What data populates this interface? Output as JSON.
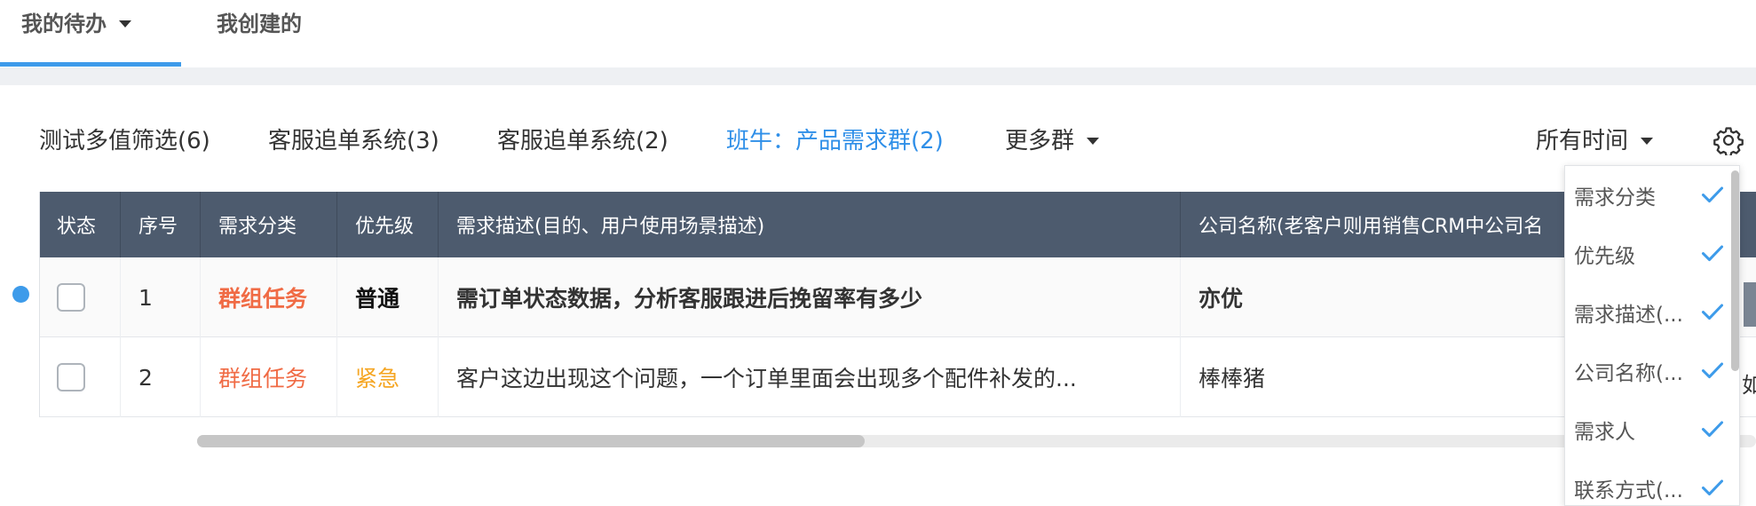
{
  "tabs": [
    {
      "label": "我的待办",
      "active": true
    },
    {
      "label": "我创建的",
      "active": false
    }
  ],
  "filters": [
    {
      "label": "测试多值筛选(6)",
      "active": false
    },
    {
      "label": "客服追单系统(3)",
      "active": false
    },
    {
      "label": "客服追单系统(2)",
      "active": false
    },
    {
      "label": "班牛：产品需求群(2)",
      "active": true
    },
    {
      "label": "更多群",
      "active": false
    }
  ],
  "time_filter": {
    "label": "所有时间"
  },
  "table": {
    "columns": [
      "状态",
      "序号",
      "需求分类",
      "优先级",
      "需求描述(目的、用户使用场景描述)",
      "公司名称(老客户则用销售CRM中公司名"
    ],
    "rows": [
      {
        "index": "1",
        "category": "群组任务",
        "priority": "普通",
        "description": "需订单状态数据，分析客服跟进后挽留率有多少",
        "company": "亦优",
        "unread": true
      },
      {
        "index": "2",
        "category": "群组任务",
        "priority": "紧急",
        "description": "客户这边出现这个问题，一个订单里面会出现多个配件补发的...",
        "company": "棒棒猪",
        "unread": false
      }
    ]
  },
  "column_menu": [
    {
      "label": "需求分类",
      "checked": true
    },
    {
      "label": "优先级",
      "checked": true
    },
    {
      "label": "需求描述(...",
      "checked": true
    },
    {
      "label": "公司名称(...",
      "checked": true
    },
    {
      "label": "需求人",
      "checked": true
    },
    {
      "label": "联系方式(...",
      "checked": true
    }
  ],
  "right_edge_text": "如",
  "colors": {
    "accent": "#3d9bea",
    "header_bg": "#4d5b6e",
    "category": "#f06b45",
    "urgent": "#f5a623"
  },
  "icons": {
    "settings": "gear-icon",
    "check": "check-icon",
    "dropdown": "caret-down-icon"
  }
}
